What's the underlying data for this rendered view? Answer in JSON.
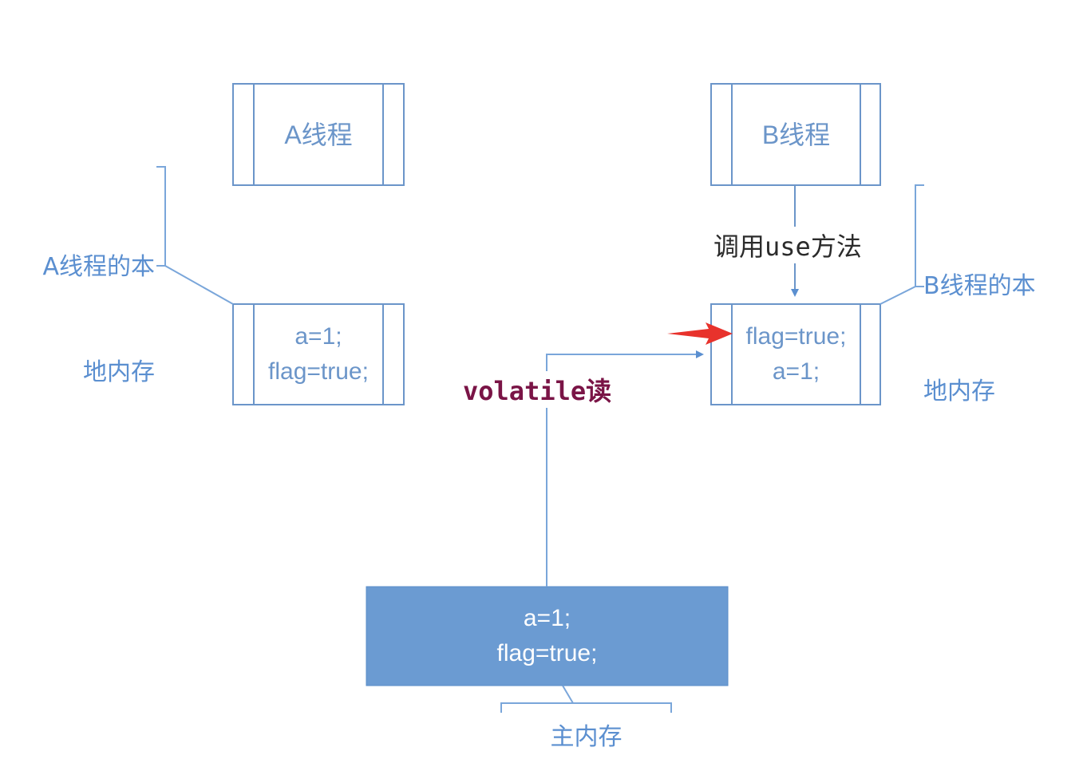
{
  "thread_a": {
    "title": "A线程",
    "local_memory_label_line1": "A线程的本",
    "local_memory_label_line2": "地内存",
    "local_values": [
      "a=1;",
      "flag=true;"
    ]
  },
  "thread_b": {
    "title": "B线程",
    "local_memory_label_line1": "B线程的本",
    "local_memory_label_line2": "地内存",
    "local_values": [
      "flag=true;",
      "a=1;"
    ],
    "call_label_prefix": "调用",
    "call_label_method": "use",
    "call_label_suffix": "方法"
  },
  "volatile_read": {
    "keyword": "volatile",
    "suffix": "读"
  },
  "main_memory": {
    "values": [
      "a=1;",
      "flag=true;"
    ],
    "label": "主内存"
  },
  "colors": {
    "box_border": "#6b95c9",
    "box_fill": "#ffffff",
    "main_fill": "#6b9bd2",
    "label_blue": "#5b8fd0",
    "connector": "#7aa6da",
    "arrow_red": "#e8322c",
    "volatile_text": "#7a1446"
  }
}
